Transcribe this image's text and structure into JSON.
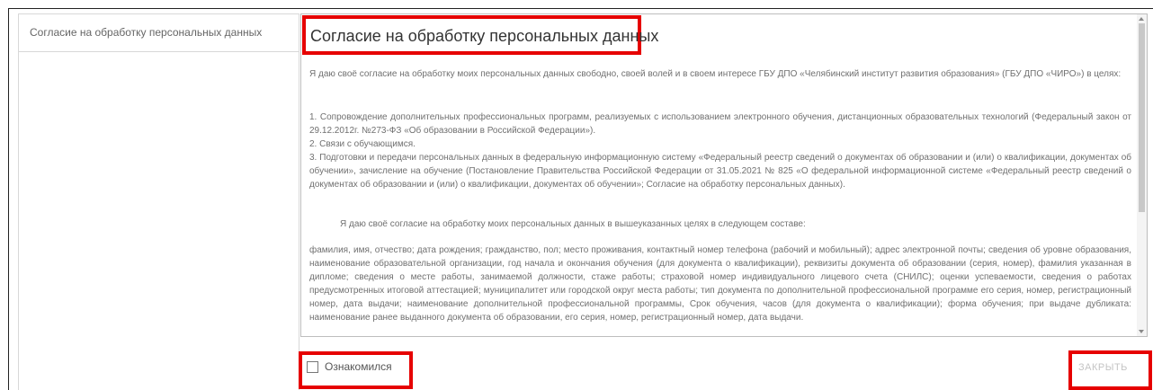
{
  "sidebar": {
    "items": [
      {
        "label": "Согласие на обработку персональных данных"
      }
    ]
  },
  "document": {
    "title": "Согласие на обработку персональных данных",
    "intro": "Я даю своё согласие на обработку моих персональных данных свободно, своей волей и в своем интересе ГБУ ДПО «Челябинский институт развития образования» (ГБУ ДПО «ЧИРО») в целях:",
    "item1": "1. Сопровождение дополнительных профессиональных программ, реализуемых с использованием электронного обучения, дистанционных образовательных технологий (Федеральный закон от 29.12.2012г. №273-ФЗ «Об образовании в Российской Федерации»).",
    "item2": "2. Связи с обучающимся.",
    "item3": "3. Подготовки и передачи персональных данных в федеральную информационную систему «Федеральный реестр сведений о документах об образовании и (или) о квалификации, документах об обучении», зачисление на обучение (Постановление Правительства Российской Федерации от 31.05.2021 № 825 «О федеральной информационной системе «Федеральный реестр сведений о документах об образовании и (или) о квалификации, документах об обучении»; Согласие на обработку персональных данных).",
    "consent_line": "Я даю своё согласие на обработку моих персональных данных в вышеуказанных целях в следующем составе:",
    "data_list": "фамилия, имя, отчество; дата рождения; гражданство, пол; место проживания, контактный номер телефона (рабочий и мобильный); адрес электронной почты; сведения об уровне образования, наименование образовательной организации, год начала и окончания обучения (для документа о квалификации), реквизиты документа об образовании (серия, номер), фамилия указанная в дипломе; сведения о месте работы, занимаемой должности, стаже работы; страховой номер индивидуального лицевого счета (СНИЛС); оценки успеваемости, сведения о работах предусмотренных итоговой аттестацией; муниципалитет или городской округ места работы; тип документа по дополнительной профессиональной программе его серия, номер, регистрационный номер, дата выдачи; наименование дополнительной профессиональной программы, Срок обучения, часов (для документа о квалификации); форма обучения;  при выдаче дубликата: наименование ранее выданного документа об образовании, его серия, номер, регистрационный номер, дата выдачи."
  },
  "footer": {
    "checkbox_label": "Ознакомился",
    "checkbox_checked": false,
    "close_label": "ЗАКРЫТЬ"
  },
  "colors": {
    "highlight": "#e60000",
    "text": "#707070",
    "disabled": "#c4c4c4"
  }
}
